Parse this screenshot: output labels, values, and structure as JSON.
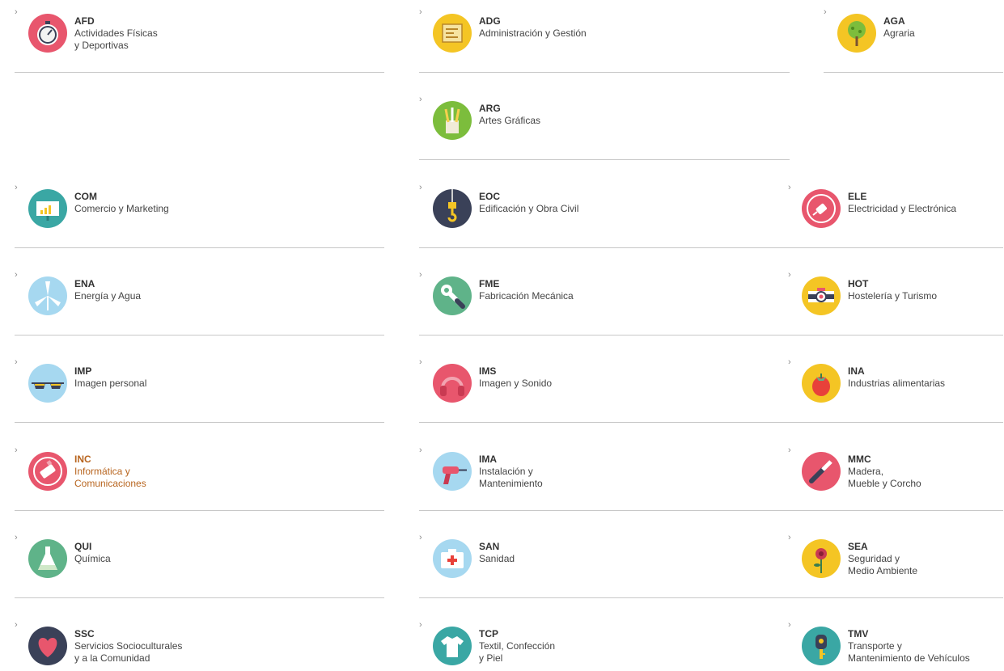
{
  "families": {
    "afd": {
      "code": "AFD",
      "name": "Actividades Físicas\ny Deportivas",
      "icon": "stopwatch-icon",
      "color": "#e8566d"
    },
    "adg": {
      "code": "ADG",
      "name": "Administración y Gestión",
      "icon": "document-icon",
      "color": "#f4c524"
    },
    "aga": {
      "code": "AGA",
      "name": "Agraria",
      "icon": "tree-icon",
      "color": "#f4c524"
    },
    "arg": {
      "code": "ARG",
      "name": "Artes Gráficas",
      "icon": "pencils-icon",
      "color": "#7cbd3c"
    },
    "com": {
      "code": "COM",
      "name": "Comercio y Marketing",
      "icon": "chart-board-icon",
      "color": "#3aa7a4"
    },
    "eoc": {
      "code": "EOC",
      "name": "Edificación y Obra Civil",
      "icon": "crane-hook-icon",
      "color": "#3a4158"
    },
    "ele": {
      "code": "ELE",
      "name": "Electricidad y Electrónica",
      "icon": "plug-icon",
      "color": "#e8566d"
    },
    "ena": {
      "code": "ENA",
      "name": "Energía y Agua",
      "icon": "wind-turbine-icon",
      "color": "#a6d8f0"
    },
    "fme": {
      "code": "FME",
      "name": "Fabricación Mecánica",
      "icon": "wrench-icon",
      "color": "#5fb389"
    },
    "hot": {
      "code": "HOT",
      "name": "Hostelería y Turismo",
      "icon": "camera-icon",
      "color": "#f4c524"
    },
    "imp": {
      "code": "IMP",
      "name": "Imagen personal",
      "icon": "sunglasses-icon",
      "color": "#a6d8f0"
    },
    "ims": {
      "code": "IMS",
      "name": "Imagen y Sonido",
      "icon": "headphones-icon",
      "color": "#e8566d"
    },
    "ina": {
      "code": "INA",
      "name": "Industrias alimentarias",
      "icon": "tomato-icon",
      "color": "#f4c524"
    },
    "inc": {
      "code": "INC",
      "name": "Informática y\nComunicaciones",
      "icon": "usb-drive-icon",
      "color": "#e8566d"
    },
    "ima": {
      "code": "IMA",
      "name": "Instalación y\nMantenimiento",
      "icon": "drill-icon",
      "color": "#a6d8f0"
    },
    "mmc": {
      "code": "MMC",
      "name": "Madera,\nMueble y Corcho",
      "icon": "chisel-icon",
      "color": "#e8566d"
    },
    "qui": {
      "code": "QUI",
      "name": "Química",
      "icon": "flask-icon",
      "color": "#5fb389"
    },
    "san": {
      "code": "SAN",
      "name": "Sanidad",
      "icon": "first-aid-kit-icon",
      "color": "#a6d8f0"
    },
    "sea": {
      "code": "SEA",
      "name": "Seguridad y\nMedio Ambiente",
      "icon": "flower-icon",
      "color": "#f4c524"
    },
    "ssc": {
      "code": "SSC",
      "name": "Servicios Socioculturales\ny a la Comunidad",
      "icon": "heart-icon",
      "color": "#3a4158"
    },
    "tcp": {
      "code": "TCP",
      "name": "Textil, Confección\ny Piel",
      "icon": "tshirt-icon",
      "color": "#3aa7a4"
    },
    "tmv": {
      "code": "TMV",
      "name": "Transporte y\nMantenimiento de Vehículos",
      "icon": "car-key-icon",
      "color": "#3aa7a4"
    }
  },
  "colors": {
    "highlight_text": "#b8651f",
    "divider": "#c8c8c8",
    "text": "#444444"
  },
  "chevron": "›"
}
